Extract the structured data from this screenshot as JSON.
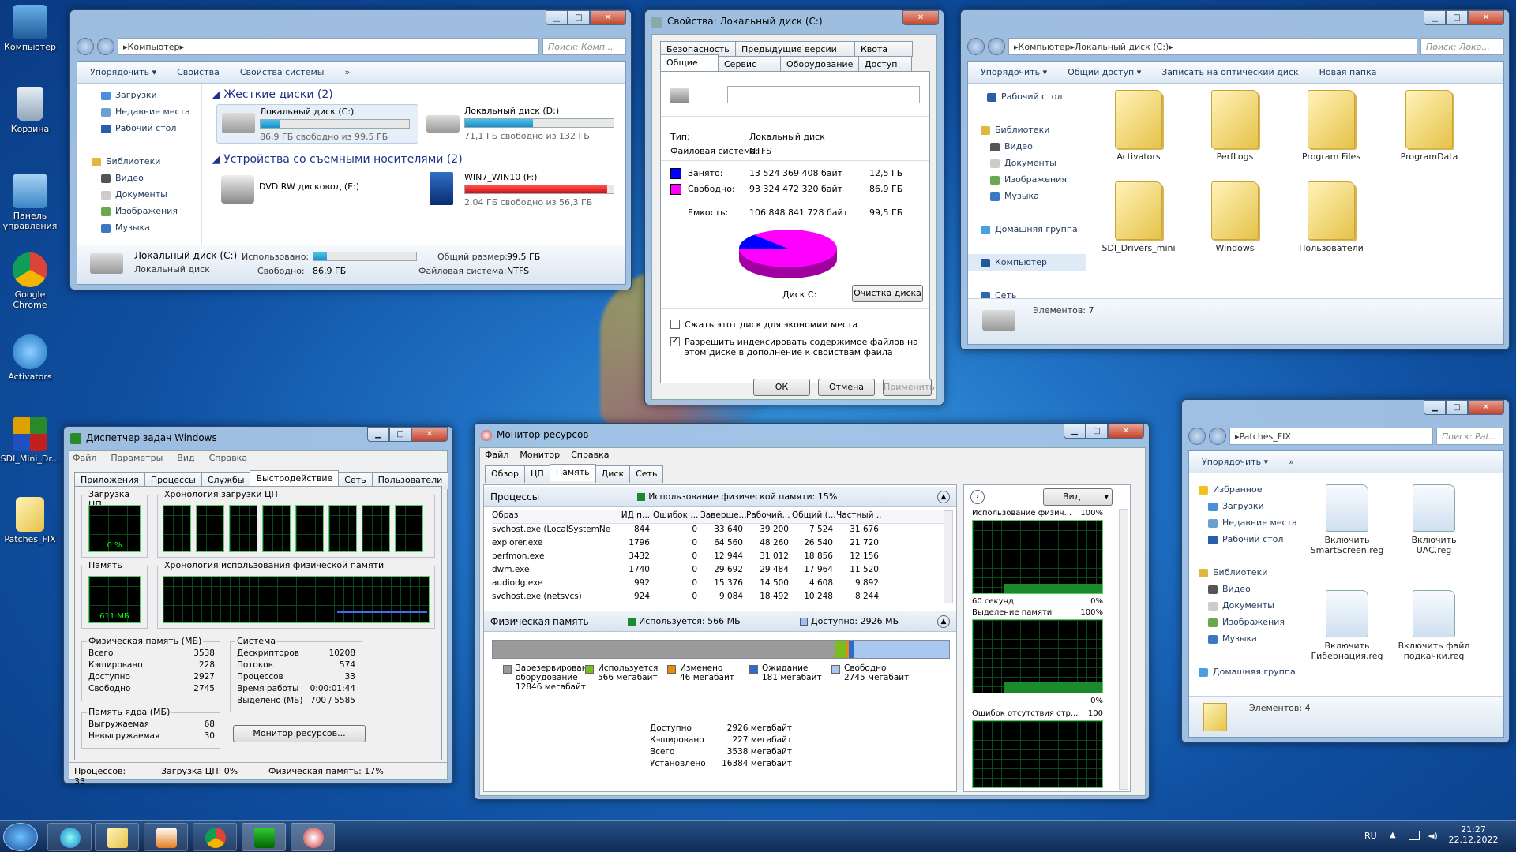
{
  "desktop_icons": [
    {
      "label": "Компьютер"
    },
    {
      "label": "Корзина"
    },
    {
      "label": "Панель управления"
    },
    {
      "label": "Google Chrome"
    },
    {
      "label": "Activators"
    },
    {
      "label": "SDI_Mini_Dr..."
    },
    {
      "label": "Patches_FIX"
    }
  ],
  "computer": {
    "address": "Компьютер",
    "search": "Поиск: Комп...",
    "toolbar": [
      "Упорядочить ▾",
      "Свойства",
      "Свойства системы",
      "»"
    ],
    "nav": [
      "Загрузки",
      "Недавние места",
      "Рабочий стол",
      "",
      "Библиотеки",
      "Видео",
      "Документы",
      "Изображения",
      "Музыка"
    ],
    "hdd_header": "Жесткие диски (2)",
    "removable_header": "Устройства со съемными носителями (2)",
    "drives": [
      {
        "name": "Локальный диск (C:)",
        "free": "86,9 ГБ свободно из 99,5 ГБ",
        "used": 0.13
      },
      {
        "name": "Локальный диск (D:)",
        "free": "71,1 ГБ свободно из 132 ГБ",
        "used": 0.46
      },
      {
        "name": "DVD RW дисковод (E:)"
      },
      {
        "name": "WIN7_WIN10 (F:)",
        "free": "2,04 ГБ свободно из 56,3 ГБ",
        "used": 0.96
      }
    ],
    "details": {
      "name": "Локальный диск (C:)",
      "type": "Локальный диск",
      "used_label": "Использовано:",
      "free_label": "Свободно:",
      "free_value": "86,9 ГБ",
      "total_label": "Общий размер:",
      "total_value": "99,5 ГБ",
      "fs_label": "Файловая система:",
      "fs_value": "NTFS",
      "used": 0.13
    }
  },
  "props": {
    "title": "Свойства: Локальный диск (C:)",
    "tabs_top": [
      "Безопасность",
      "Предыдущие версии",
      "Квота"
    ],
    "tabs_bottom": [
      "Общие",
      "Сервис",
      "Оборудование",
      "Доступ"
    ],
    "type_label": "Тип:",
    "type_value": "Локальный диск",
    "fs_label": "Файловая система:",
    "fs_value": "NTFS",
    "used_label": "Занято:",
    "used_bytes": "13 524 369 408 байт",
    "used_gb": "12,5 ГБ",
    "free_label": "Свободно:",
    "free_bytes": "93 324 472 320 байт",
    "free_gb": "86,9 ГБ",
    "cap_label": "Емкость:",
    "cap_bytes": "106 848 841 728 байт",
    "cap_gb": "99,5 ГБ",
    "disk_label": "Диск C:",
    "cleanup": "Очистка диска",
    "compress": "Сжать этот диск для экономии места",
    "index": "Разрешить индексировать содержимое файлов на этом диске в дополнение к свойствам файла",
    "ok": "ОК",
    "cancel": "Отмена",
    "apply": "Применить",
    "used_color": "#0000ff",
    "free_color": "#ff00ff",
    "used_fraction": 0.127
  },
  "cdrive": {
    "address": [
      "Компьютер",
      "Локальный диск (C:)"
    ],
    "search": "Поиск: Лока...",
    "toolbar": [
      "Упорядочить ▾",
      "Общий доступ ▾",
      "Записать на оптический диск",
      "Новая папка"
    ],
    "nav": [
      "Рабочий стол",
      "",
      "Библиотеки",
      "Видео",
      "Документы",
      "Изображения",
      "Музыка",
      "",
      "Домашняя группа",
      "",
      "Компьютер",
      "",
      "Сеть"
    ],
    "folders": [
      "Activators",
      "PerfLogs",
      "Program Files",
      "ProgramData",
      "SDI_Drivers_mini",
      "Windows",
      "Пользователи"
    ],
    "count": "Элементов: 7"
  },
  "patches": {
    "address": "Patches_FIX",
    "search": "Поиск: Pat...",
    "toolbar": [
      "Упорядочить ▾",
      "»"
    ],
    "nav": [
      "Избранное",
      "Загрузки",
      "Недавние места",
      "Рабочий стол",
      "",
      "Библиотеки",
      "Видео",
      "Документы",
      "Изображения",
      "Музыка",
      "",
      "Домашняя группа"
    ],
    "files": [
      "Включить SmartScreen.reg",
      "Включить UAC.reg",
      "Включить Гибернация.reg",
      "Включить файл подкачки.reg"
    ],
    "count": "Элементов: 4"
  },
  "taskmgr": {
    "title": "Диспетчер задач Windows",
    "menu": [
      "Файл",
      "Параметры",
      "Вид",
      "Справка"
    ],
    "tabs": [
      "Приложения",
      "Процессы",
      "Службы",
      "Быстродействие",
      "Сеть",
      "Пользователи"
    ],
    "cpu_label": "Загрузка ЦП",
    "cpu_value": "0 %",
    "cpu_hist": "Хронология загрузки ЦП",
    "mem_label": "Память",
    "mem_value": "611 МБ",
    "mem_hist": "Хронология использования физической памяти",
    "phys_title": "Физическая память (МБ)",
    "phys": [
      [
        "Всего",
        "3538"
      ],
      [
        "Кэшировано",
        "228"
      ],
      [
        "Доступно",
        "2927"
      ],
      [
        "Свободно",
        "2745"
      ]
    ],
    "sys_title": "Система",
    "sys": [
      [
        "Дескрипторов",
        "10208"
      ],
      [
        "Потоков",
        "574"
      ],
      [
        "Процессов",
        "33"
      ],
      [
        "Время работы",
        "0:00:01:44"
      ],
      [
        "Выделено (МБ)",
        "700 / 5585"
      ]
    ],
    "kernel_title": "Память ядра (МБ)",
    "kernel": [
      [
        "Выгружаемая",
        "68"
      ],
      [
        "Невыгружаемая",
        "30"
      ]
    ],
    "resmon_btn": "Монитор ресурсов...",
    "status": [
      "Процессов: 33",
      "Загрузка ЦП: 0%",
      "Физическая память: 17%"
    ]
  },
  "resmon": {
    "title": "Монитор ресурсов",
    "menu": [
      "Файл",
      "Монитор",
      "Справка"
    ],
    "tabs": [
      "Обзор",
      "ЦП",
      "Память",
      "Диск",
      "Сеть"
    ],
    "proc_title": "Процессы",
    "proc_usage": "Использование физической памяти: 15%",
    "cols": [
      "Образ",
      "ИД п...",
      "Ошибок ...",
      "Заверше...",
      "Рабочий...",
      "Общий (...",
      "Частный ..."
    ],
    "rows": [
      [
        "svchost.exe (LocalSystemNet...",
        "844",
        "0",
        "33 640",
        "39 200",
        "7 524",
        "31 676"
      ],
      [
        "explorer.exe",
        "1796",
        "0",
        "64 560",
        "48 260",
        "26 540",
        "21 720"
      ],
      [
        "perfmon.exe",
        "3432",
        "0",
        "12 944",
        "31 012",
        "18 856",
        "12 156"
      ],
      [
        "dwm.exe",
        "1740",
        "0",
        "29 692",
        "29 484",
        "17 964",
        "11 520"
      ],
      [
        "audiodg.exe",
        "992",
        "0",
        "15 376",
        "14 500",
        "4 608",
        "9 892"
      ],
      [
        "svchost.exe (netsvcs)",
        "924",
        "0",
        "9 084",
        "18 492",
        "10 248",
        "8 244"
      ]
    ],
    "phys_title": "Физическая память",
    "phys_used": "Используется: 566 МБ",
    "phys_avail": "Доступно: 2926 МБ",
    "legend": [
      {
        "name": "Зарезервировано оборудование",
        "value": "12846 мегабайт",
        "color": "#9a9a9a"
      },
      {
        "name": "Используется",
        "value": "566 мегабайт",
        "color": "#7cbd1e"
      },
      {
        "name": "Изменено",
        "value": "46 мегабайт",
        "color": "#e88a10"
      },
      {
        "name": "Ожидание",
        "value": "181 мегабайт",
        "color": "#2e6bd0"
      },
      {
        "name": "Свободно",
        "value": "2745 мегабайт",
        "color": "#a9c8f0"
      }
    ],
    "summary": [
      [
        "Доступно",
        "2926 мегабайт"
      ],
      [
        "Кэшировано",
        "227 мегабайт"
      ],
      [
        "Всего",
        "3538 мегабайт"
      ],
      [
        "Установлено",
        "16384 мегабайт"
      ]
    ],
    "view": "Вид",
    "g1": "Использование физич...",
    "g1p": "100%",
    "g1s": "60 секунд",
    "g1z": "0%",
    "g2": "Выделение памяти",
    "g2p": "100%",
    "g2z": "0%",
    "g3": "Ошибок отсутствия стр...",
    "g3p": "100"
  },
  "tray": {
    "lang": "RU",
    "time": "21:27",
    "date": "22.12.2022"
  }
}
